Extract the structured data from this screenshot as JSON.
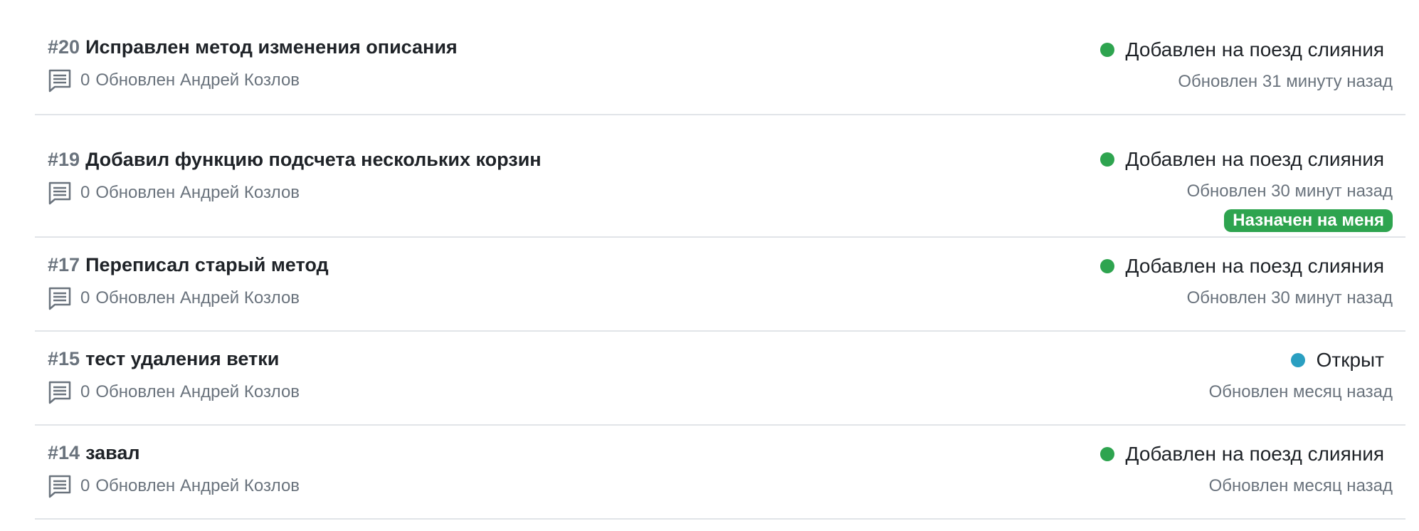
{
  "colors": {
    "merge_train": "#2ea44f",
    "open": "#2a9fc1",
    "badge": "#2ea44f"
  },
  "items": [
    {
      "number": "#20",
      "title": "Исправлен метод изменения описания",
      "comments": "0",
      "meta": "Обновлен Андрей Козлов",
      "status": "Добавлен на поезд слияния",
      "updated": "Обновлен 31 минуту назад"
    },
    {
      "number": "#19",
      "title": "Добавил функцию подсчета нескольких корзин",
      "comments": "0",
      "meta": "Обновлен Андрей Козлов",
      "status": "Добавлен на поезд слияния",
      "updated": "Обновлен 30 минут назад",
      "badge": "Назначен на меня"
    },
    {
      "number": "#17",
      "title": "Переписал старый метод",
      "comments": "0",
      "meta": "Обновлен Андрей Козлов",
      "status": "Добавлен на поезд слияния",
      "updated": "Обновлен 30 минут назад"
    },
    {
      "number": "#15",
      "title": "тест удаления ветки",
      "comments": "0",
      "meta": "Обновлен Андрей Козлов",
      "status": "Открыт",
      "updated": "Обновлен месяц назад"
    },
    {
      "number": "#14",
      "title": "завал",
      "comments": "0",
      "meta": "Обновлен Андрей Козлов",
      "status": "Добавлен на поезд слияния",
      "updated": "Обновлен месяц назад"
    }
  ]
}
